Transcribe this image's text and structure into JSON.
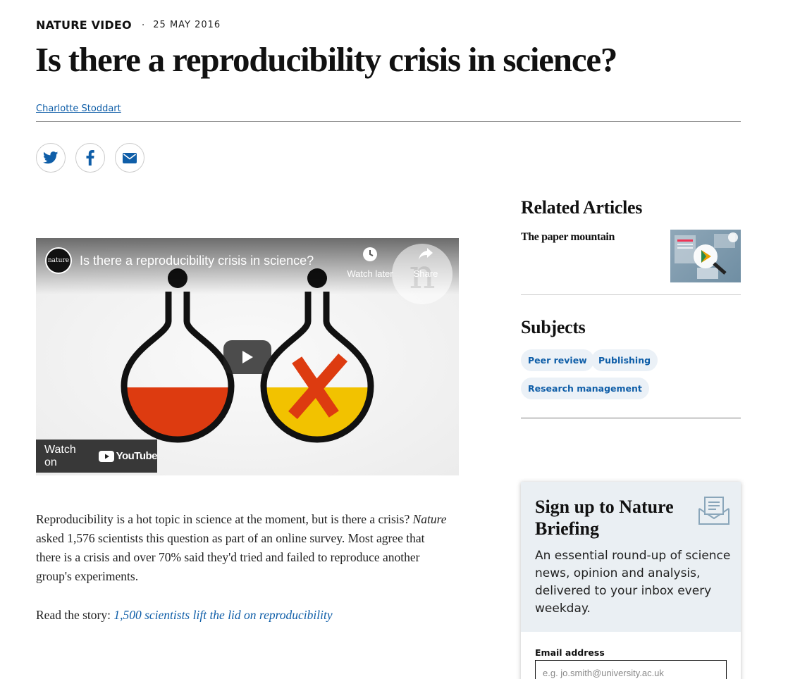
{
  "header": {
    "article_type": "NATURE VIDEO",
    "separator": "·",
    "date": "25 MAY 2016",
    "title": "Is there a reproducibility crisis in science?",
    "author": "Charlotte Stoddart"
  },
  "share": {
    "icons": [
      "twitter-icon",
      "facebook-icon",
      "email-icon"
    ]
  },
  "video": {
    "channel_badge": "nature",
    "title": "Is there a reproducibility crisis in science?",
    "watch_later_label": "Watch later",
    "share_label": "Share",
    "watch_on_label": "Watch on",
    "youtube_label": "YouTube"
  },
  "article": {
    "para1_em": "Nature",
    "para1_pre": "Reproducibility is a hot topic in science at the moment, but is there a crisis? ",
    "para1_post": " asked 1,576 scientists this question as part of an online survey. Most agree that there is a crisis and over 70% said they'd tried and failed to reproduce another group's experiments.",
    "read_prefix": "Read the story: ",
    "read_link": "1,500 scientists lift the lid on reproducibility"
  },
  "sidebar": {
    "related_heading": "Related Articles",
    "related_items": [
      {
        "title": "The paper mountain"
      }
    ],
    "subjects_heading": "Subjects",
    "subjects": [
      "Peer review",
      "Publishing",
      "Research management"
    ]
  },
  "briefing": {
    "heading": "Sign up to Nature Briefing",
    "description": "An essential round-up of science news, opinion and analysis, delivered to your inbox every weekday.",
    "email_label": "Email address",
    "email_placeholder": "e.g. jo.smith@university.ac.uk"
  },
  "colors": {
    "link": "#0f5ea8",
    "pill_bg": "#ebf1f7",
    "briefing_bg": "#eaeff3",
    "flask_red": "#dd3b10",
    "flask_yellow": "#f2c200"
  }
}
